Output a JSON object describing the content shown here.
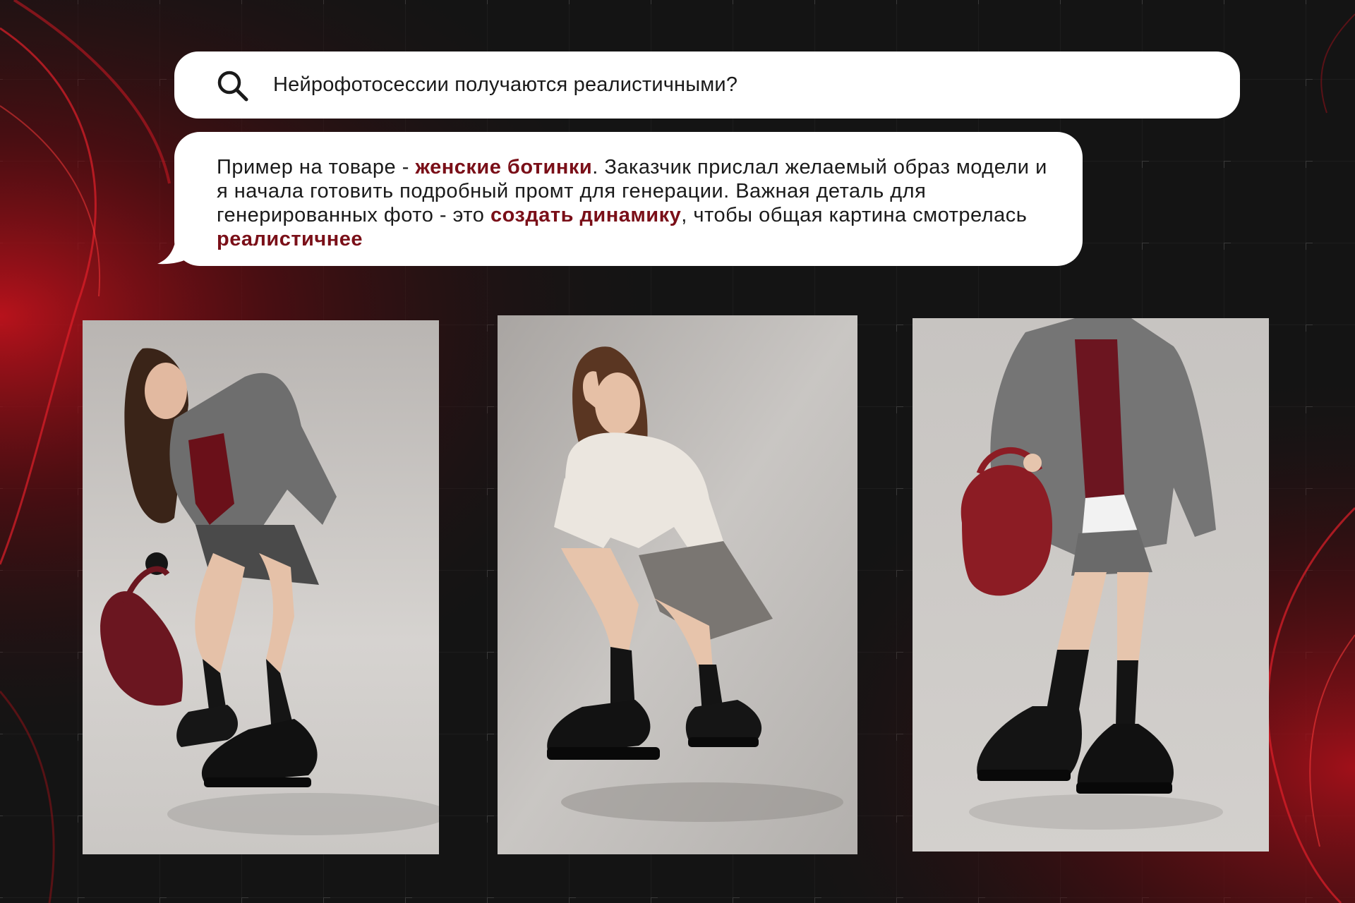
{
  "search": {
    "query": "Нейрофотосессии получаются реалистичными?",
    "icon": "search-icon"
  },
  "message": {
    "part1": "Пример на товаре - ",
    "highlight1": "женские ботинки",
    "part2": ". Заказчик прислал желаемый образ модели и я начала готовить подробный промт для генерации. Важная деталь для генерированных фото - это ",
    "highlight2": "создать динамику",
    "part3": ", чтобы общая картина смотрелась ",
    "highlight3": "реалистичнее"
  },
  "colors": {
    "background": "#141414",
    "accent": "#7a0f18",
    "bubble": "#ffffff"
  },
  "photos": [
    {
      "icon": "photo-model-bending-icon"
    },
    {
      "icon": "photo-model-crouching-icon"
    },
    {
      "icon": "photo-model-standing-icon"
    }
  ]
}
